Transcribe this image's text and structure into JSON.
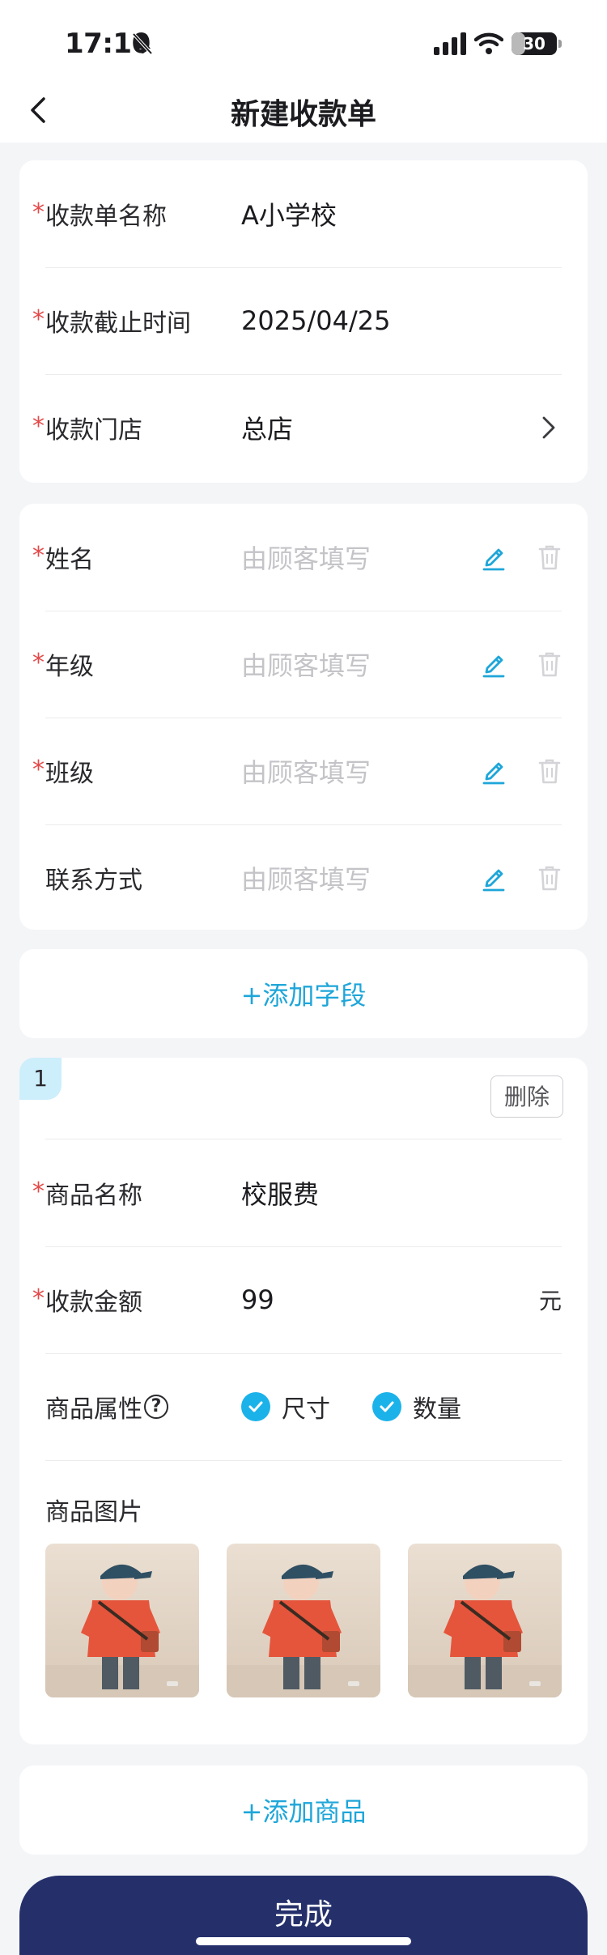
{
  "status": {
    "time": "17:10",
    "battery": "30",
    "battery_level": 0.3
  },
  "nav": {
    "title": "新建收款单"
  },
  "basic": [
    {
      "label": "收款单名称",
      "value": "A小学校",
      "required": true
    },
    {
      "label": "收款截止时间",
      "value": "2025/04/25",
      "required": true
    },
    {
      "label": "收款门店",
      "value": "总店",
      "required": true
    }
  ],
  "fields": [
    {
      "label": "姓名",
      "placeholder": "由顾客填写",
      "required": true
    },
    {
      "label": "年级",
      "placeholder": "由顾客填写",
      "required": true
    },
    {
      "label": "班级",
      "placeholder": "由顾客填写",
      "required": true
    },
    {
      "label": "联系方式",
      "placeholder": "由顾客填写",
      "required": false
    }
  ],
  "add_field_label": "+添加字段",
  "goods": {
    "index": "1",
    "delete_label": "删除",
    "name_label": "商品名称",
    "name_value": "校服费",
    "amount_label": "收款金额",
    "amount_value": "99",
    "unit": "元",
    "attr_label": "商品属性",
    "help_icon": "?",
    "attr_options": [
      "尺寸",
      "数量"
    ],
    "image_label": "商品图片"
  },
  "add_goods_label": "+添加商品",
  "done_label": "完成",
  "colors": {
    "accent": "#1ea6d9",
    "primary_button": "#25306b",
    "required": "#e44a4a",
    "checkbox": "#1bb2ea"
  }
}
